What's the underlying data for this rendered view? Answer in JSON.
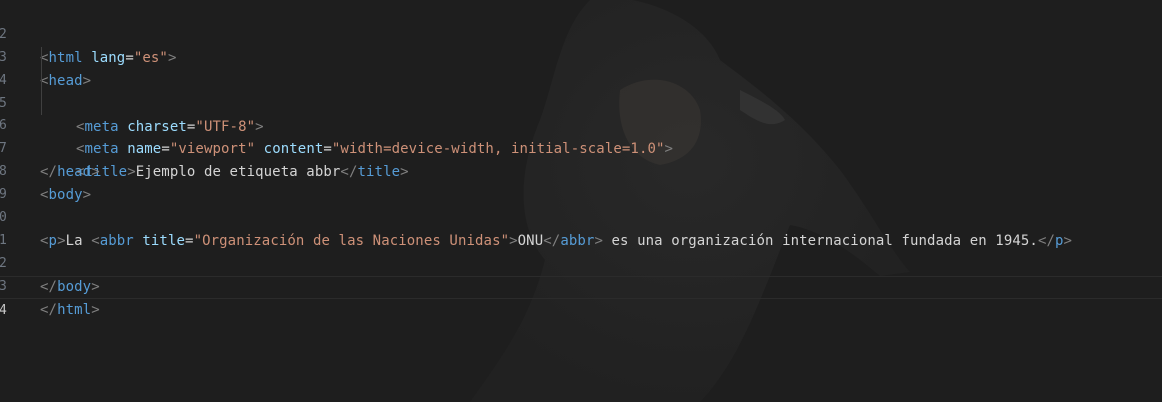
{
  "editor": {
    "language": "html",
    "active_line": "4",
    "colors": {
      "background": "#1e1e1e",
      "tag": "#569cd6",
      "bracket": "#808080",
      "attribute": "#9cdcfe",
      "string": "#ce9178",
      "text": "#d4d4d4",
      "line_number": "#6e7681"
    },
    "lines": [
      {
        "num": "2",
        "code": "<html lang=\"es\">"
      },
      {
        "num": "3",
        "code": "<head>"
      },
      {
        "num": "4",
        "code": "<meta charset=\"UTF-8\">"
      },
      {
        "num": "5",
        "code": "<meta name=\"viewport\" content=\"width=device-width, initial-scale=1.0\">"
      },
      {
        "num": "6",
        "code": "<title>Ejemplo de etiqueta abbr</title>"
      },
      {
        "num": "7",
        "code": "</head>"
      },
      {
        "num": "8",
        "code": "<body>"
      },
      {
        "num": "9",
        "code": ""
      },
      {
        "num": "0",
        "code": "<p>La <abbr title=\"Organización de las Naciones Unidas\">ONU</abbr> es una organización internacional fundada en 1945.</p>"
      },
      {
        "num": "1",
        "code": ""
      },
      {
        "num": "2",
        "code": "</body>"
      },
      {
        "num": "3",
        "code": "</html>"
      },
      {
        "num": "4",
        "code": ""
      }
    ]
  }
}
